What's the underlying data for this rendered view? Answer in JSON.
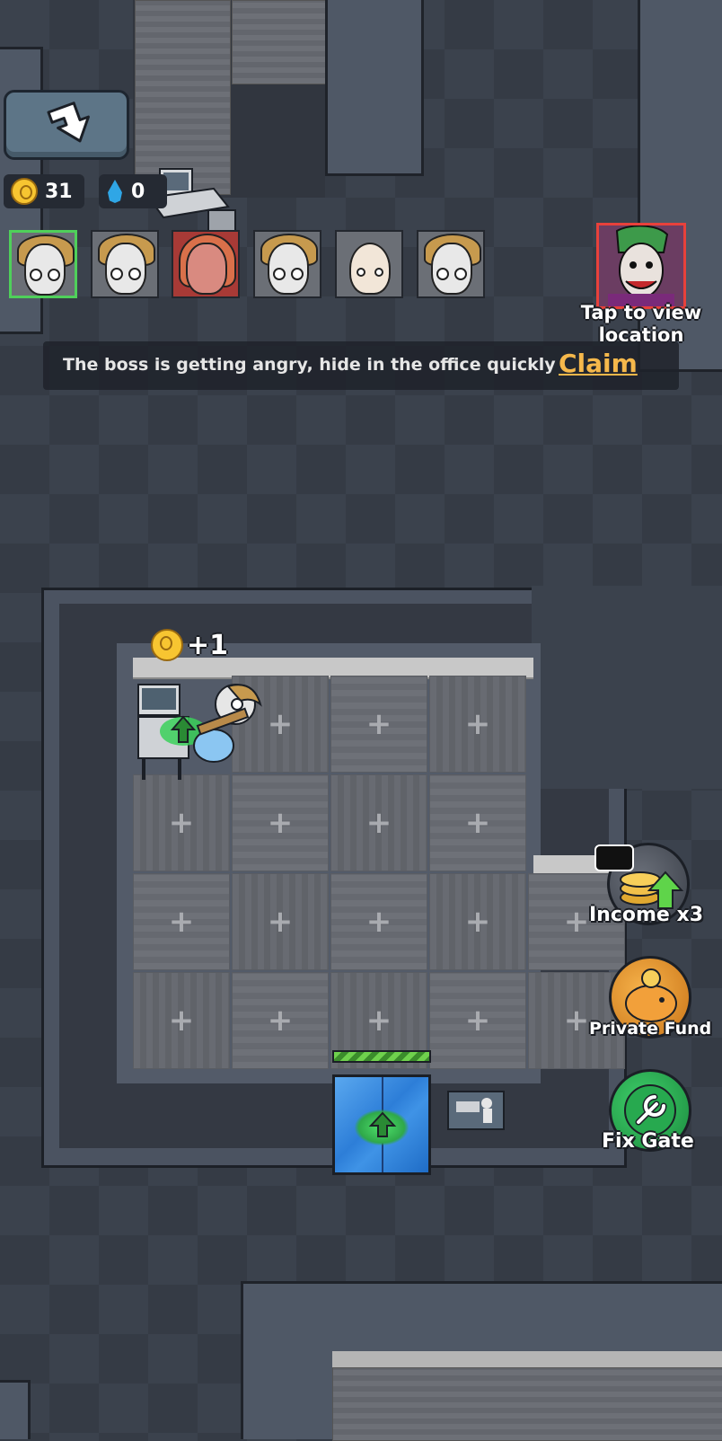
{
  "hud": {
    "coins": "31",
    "water": "0",
    "coin_icon": "coin-icon",
    "water_icon": "water-drop-icon"
  },
  "characters": [
    {
      "name": "girl-avatar",
      "selected": true
    },
    {
      "name": "girl-avatar"
    },
    {
      "name": "red-haired-avatar",
      "state": "danger"
    },
    {
      "name": "girl-avatar"
    },
    {
      "name": "bald-man-avatar"
    },
    {
      "name": "girl-avatar"
    }
  ],
  "boss": {
    "label": "Tap to view location"
  },
  "notice": {
    "text": "The boss is getting angry, hide in the office quickly",
    "action": "Claim"
  },
  "office": {
    "income_popup": "+1",
    "tile_symbol": "+"
  },
  "side_actions": {
    "income": "Income x3",
    "fund": "Private Fund",
    "fix": "Fix Gate"
  },
  "colors": {
    "accent_claim": "#f5b84b",
    "gate_green": "#4fd05a",
    "door_blue": "#2d7ed8",
    "boss_border": "#e8413b"
  }
}
